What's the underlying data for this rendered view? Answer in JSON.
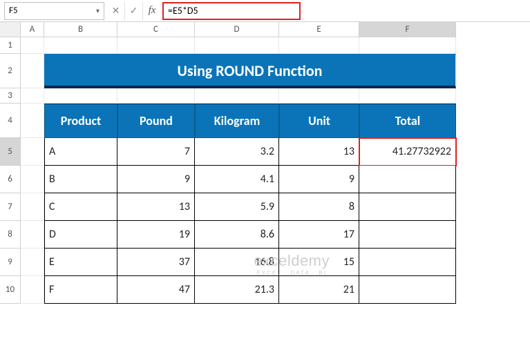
{
  "namebox": "F5",
  "formula": "=E5*D5",
  "fx_label": "fx",
  "col_headers": {
    "A": "A",
    "B": "B",
    "C": "C",
    "D": "D",
    "E": "E",
    "F": "F"
  },
  "row_headers": [
    "1",
    "2",
    "3",
    "4",
    "5",
    "6",
    "7",
    "8",
    "9",
    "10"
  ],
  "title": "Using ROUND Function",
  "headers": {
    "product": "Product",
    "pound": "Pound",
    "kilogram": "Kilogram",
    "unit": "Unit",
    "total": "Total"
  },
  "rows": [
    {
      "product": "A",
      "pound": "7",
      "kilogram": "3.2",
      "unit": "13",
      "total": "41.27732922"
    },
    {
      "product": "B",
      "pound": "9",
      "kilogram": "4.1",
      "unit": "9",
      "total": ""
    },
    {
      "product": "C",
      "pound": "13",
      "kilogram": "5.9",
      "unit": "8",
      "total": ""
    },
    {
      "product": "D",
      "pound": "19",
      "kilogram": "8.6",
      "unit": "17",
      "total": ""
    },
    {
      "product": "E",
      "pound": "37",
      "kilogram": "16.8",
      "unit": "15",
      "total": ""
    },
    {
      "product": "F",
      "pound": "47",
      "kilogram": "21.3",
      "unit": "21",
      "total": ""
    }
  ],
  "watermark": {
    "brand": "exceldemy",
    "tag": "EXCEL · DATA · BI"
  },
  "chart_data": {
    "type": "table",
    "title": "Using ROUND Function",
    "columns": [
      "Product",
      "Pound",
      "Kilogram",
      "Unit",
      "Total"
    ],
    "data": [
      [
        "A",
        7,
        3.2,
        13,
        41.27732922
      ],
      [
        "B",
        9,
        4.1,
        9,
        null
      ],
      [
        "C",
        13,
        5.9,
        8,
        null
      ],
      [
        "D",
        19,
        8.6,
        17,
        null
      ],
      [
        "E",
        37,
        16.8,
        15,
        null
      ],
      [
        "F",
        47,
        21.3,
        21,
        null
      ]
    ]
  }
}
